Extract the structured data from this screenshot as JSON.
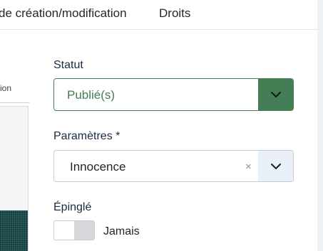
{
  "tabs": {
    "dates_label": "de création/modification",
    "rights_label": "Droits"
  },
  "left_panel": {
    "caption": "ion"
  },
  "fields": {
    "status": {
      "label": "Statut",
      "value": "Publié(s)"
    },
    "params": {
      "label": "Paramètres *",
      "value": "Innocence",
      "clear_symbol": "×"
    },
    "pinned": {
      "label": "Épinglé",
      "switch_label": "Jamais"
    }
  },
  "colors": {
    "status_accent": "#457d54",
    "label_text": "#1b2b44",
    "toggle_bg_neutral": "#eaf0f7"
  },
  "icons": {
    "status_toggle": "chevron-down-icon",
    "params_toggle": "chevron-down-icon",
    "params_clear": "close-icon"
  }
}
